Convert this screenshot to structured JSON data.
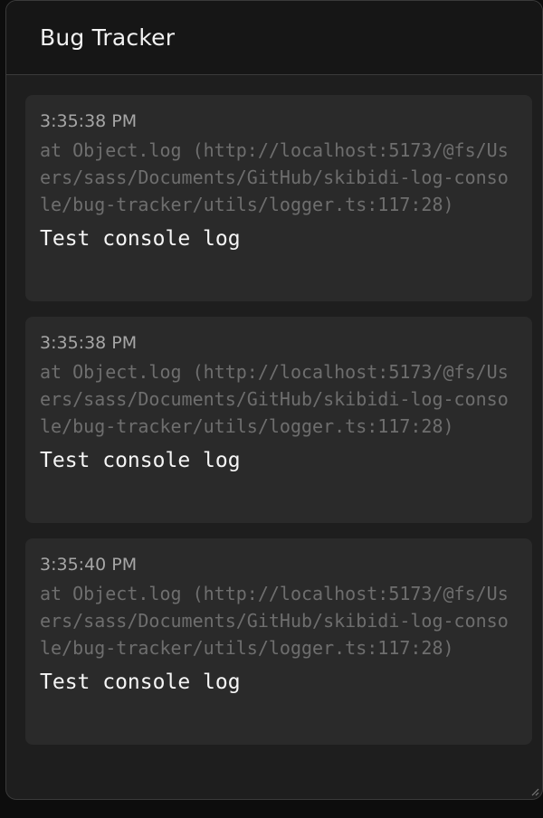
{
  "header": {
    "title": "Bug Tracker"
  },
  "logs": [
    {
      "time": "3:35:38 PM",
      "source": "at Object.log (http://localhost:5173/@fs/Users/sass/Documents/GitHub/skibidi-log-console/bug-tracker/utils/logger.ts:117:28)",
      "message": "Test console log"
    },
    {
      "time": "3:35:38 PM",
      "source": "at Object.log (http://localhost:5173/@fs/Users/sass/Documents/GitHub/skibidi-log-console/bug-tracker/utils/logger.ts:117:28)",
      "message": "Test console log"
    },
    {
      "time": "3:35:40 PM",
      "source": "at Object.log (http://localhost:5173/@fs/Users/sass/Documents/GitHub/skibidi-log-console/bug-tracker/utils/logger.ts:117:28)",
      "message": "Test console log"
    }
  ],
  "icons": {
    "resize": "resize-grip-icon"
  },
  "colors": {
    "panel_background": "#1e1e1e",
    "header_background": "#161616",
    "card_background": "#2a2a2a",
    "time_text": "#a6a6a6",
    "source_text": "#6e6e6e",
    "message_text": "#f5f5f5"
  }
}
